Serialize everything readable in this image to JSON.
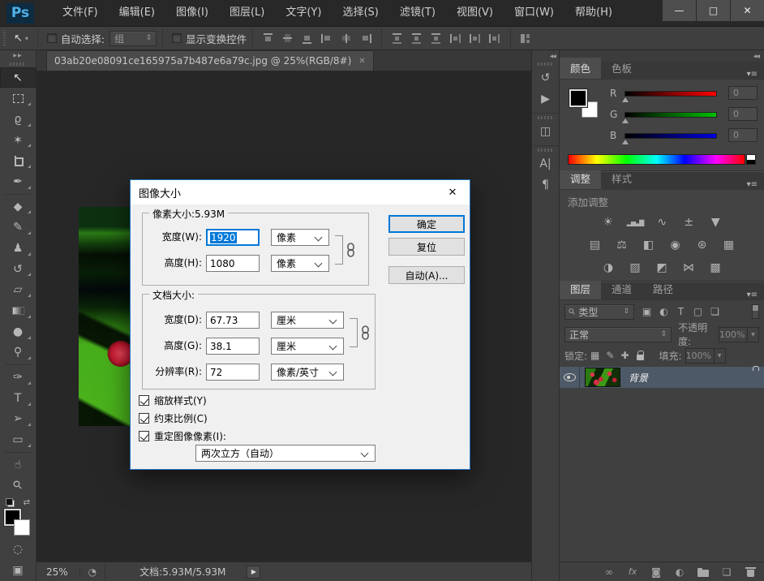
{
  "titlebar": {
    "logo": "Ps",
    "menus": [
      "文件(F)",
      "编辑(E)",
      "图像(I)",
      "图层(L)",
      "文字(Y)",
      "选择(S)",
      "滤镜(T)",
      "视图(V)",
      "窗口(W)",
      "帮助(H)"
    ],
    "window": {
      "minimize": "—",
      "maximize": "□",
      "close": "✕"
    }
  },
  "options": {
    "auto_select_label": "自动选择:",
    "auto_select_value": "组",
    "show_transform_label": "显示变换控件"
  },
  "doc_tab": {
    "title": "03ab20e08091ce165975a7b487e6a79c.jpg @ 25%(RGB/8#)",
    "close": "✕"
  },
  "toolbar": {
    "expand": "▶▶",
    "swap_glyph": "⇄",
    "quick_mask_glyph": "◌",
    "screen_mode_glyph": "▣",
    "tools": [
      {
        "name": "move",
        "glyph": "↖"
      },
      {
        "name": "rectangular-marquee",
        "glyph": ""
      },
      {
        "name": "lasso",
        "glyph": "ϱ"
      },
      {
        "name": "magic-wand",
        "glyph": "✶"
      },
      {
        "name": "crop",
        "glyph": ""
      },
      {
        "name": "eyedropper",
        "glyph": "✒"
      },
      {
        "name": "spot-healing-brush",
        "glyph": "◆"
      },
      {
        "name": "brush",
        "glyph": "✎"
      },
      {
        "name": "clone-stamp",
        "glyph": "♟"
      },
      {
        "name": "history-brush",
        "glyph": "↺"
      },
      {
        "name": "eraser",
        "glyph": "▱"
      },
      {
        "name": "gradient",
        "glyph": ""
      },
      {
        "name": "blur",
        "glyph": "●"
      },
      {
        "name": "dodge",
        "glyph": "⚲"
      },
      {
        "name": "pen",
        "glyph": "✑"
      },
      {
        "name": "type",
        "glyph": "T"
      },
      {
        "name": "path-selection",
        "glyph": "➢"
      },
      {
        "name": "rectangle",
        "glyph": "▭"
      },
      {
        "name": "hand",
        "glyph": "☝"
      },
      {
        "name": "zoom",
        "glyph": "⚲"
      }
    ]
  },
  "strip": {
    "collapse": "◀◀",
    "icons": [
      {
        "name": "history",
        "glyph": "↺"
      },
      {
        "name": "actions",
        "glyph": "▶"
      },
      {
        "name": "properties",
        "glyph": "◫"
      },
      {
        "name": "character",
        "glyph": "A|"
      },
      {
        "name": "paragraph",
        "glyph": "¶"
      }
    ]
  },
  "color_panel": {
    "tab_color": "颜色",
    "tab_swatches": "色板",
    "menu": "▾≡",
    "channels": [
      {
        "label": "R",
        "value": "0"
      },
      {
        "label": "G",
        "value": "0"
      },
      {
        "label": "B",
        "value": "0"
      }
    ]
  },
  "adjust_panel": {
    "tab_adjust": "调整",
    "tab_styles": "样式",
    "menu": "▾≡",
    "hint": "添加调整",
    "icons": [
      {
        "name": "brightness-contrast",
        "glyph": "☀"
      },
      {
        "name": "levels",
        "glyph": "▂▅▃▇"
      },
      {
        "name": "curves",
        "glyph": "∿"
      },
      {
        "name": "exposure",
        "glyph": "±"
      },
      {
        "name": "vibrance",
        "glyph": "▼"
      },
      {
        "name": "hue-saturation",
        "glyph": "▤"
      },
      {
        "name": "color-balance",
        "glyph": "⚖"
      },
      {
        "name": "black-white",
        "glyph": "◧"
      },
      {
        "name": "photo-filter",
        "glyph": "◉"
      },
      {
        "name": "channel-mixer",
        "glyph": "⊛"
      },
      {
        "name": "color-lookup",
        "glyph": "▦"
      },
      {
        "name": "invert",
        "glyph": "◑"
      },
      {
        "name": "posterize",
        "glyph": "▨"
      },
      {
        "name": "threshold",
        "glyph": "◩"
      },
      {
        "name": "gradient-map",
        "glyph": "⋈"
      },
      {
        "name": "selective-color",
        "glyph": "▩"
      }
    ]
  },
  "layers_panel": {
    "tab_layers": "图层",
    "tab_channels": "通道",
    "tab_paths": "路径",
    "menu": "▾≡",
    "filter_type": "类型",
    "filter_icons": [
      {
        "name": "filter-pixel-layers",
        "glyph": "▣"
      },
      {
        "name": "filter-adjustment-layers",
        "glyph": "◐"
      },
      {
        "name": "filter-type-layers",
        "glyph": "T"
      },
      {
        "name": "filter-shape-layers",
        "glyph": "▢"
      },
      {
        "name": "filter-smart-objects",
        "glyph": "❏"
      }
    ],
    "blend_mode": "正常",
    "opacity_label": "不透明度:",
    "opacity_value": "100%",
    "lock_label": "锁定:",
    "lock_icons": [
      {
        "name": "lock-transparency",
        "glyph": "▦"
      },
      {
        "name": "lock-pixels",
        "glyph": "✎"
      },
      {
        "name": "lock-position",
        "glyph": "✚"
      }
    ],
    "fill_label": "填充:",
    "fill_value": "100%",
    "layer_name": "背景",
    "bottom": {
      "link": "∞",
      "fx": "fx",
      "mask": "◙",
      "adjustment": "◐",
      "new_layer": "❏"
    }
  },
  "status": {
    "zoom": "25%",
    "icon": "◔",
    "doc_label": "文档:5.93M/5.93M",
    "arrow": "▶"
  },
  "dialog": {
    "title": "图像大小",
    "close": "✕",
    "pixel_group": {
      "legend": "像素大小:5.93M",
      "width_label": "宽度(W):",
      "width_value": "1920",
      "width_unit": "像素",
      "height_label": "高度(H):",
      "height_value": "1080",
      "height_unit": "像素"
    },
    "doc_group": {
      "legend": "文档大小:",
      "width_label": "宽度(D):",
      "width_value": "67.73",
      "width_unit": "厘米",
      "height_label": "高度(G):",
      "height_value": "38.1",
      "height_unit": "厘米",
      "res_label": "分辨率(R):",
      "res_value": "72",
      "res_unit": "像素/英寸"
    },
    "checks": {
      "scale_styles": "缩放样式(Y)",
      "constrain": "约束比例(C)",
      "resample": "重定图像像素(I):"
    },
    "resample_method": "两次立方（自动）",
    "buttons": {
      "ok": "确定",
      "reset": "复位",
      "auto": "自动(A)..."
    }
  },
  "glyphs": {
    "updown": "⇕",
    "dropdown": "▼",
    "search": "⚲",
    "tool_arrow": "▾"
  },
  "colors": {
    "accent": "#0078d7",
    "selected_layer_row": "#4d5966",
    "panel_bg": "#424242",
    "canvas_bg": "#272727"
  }
}
